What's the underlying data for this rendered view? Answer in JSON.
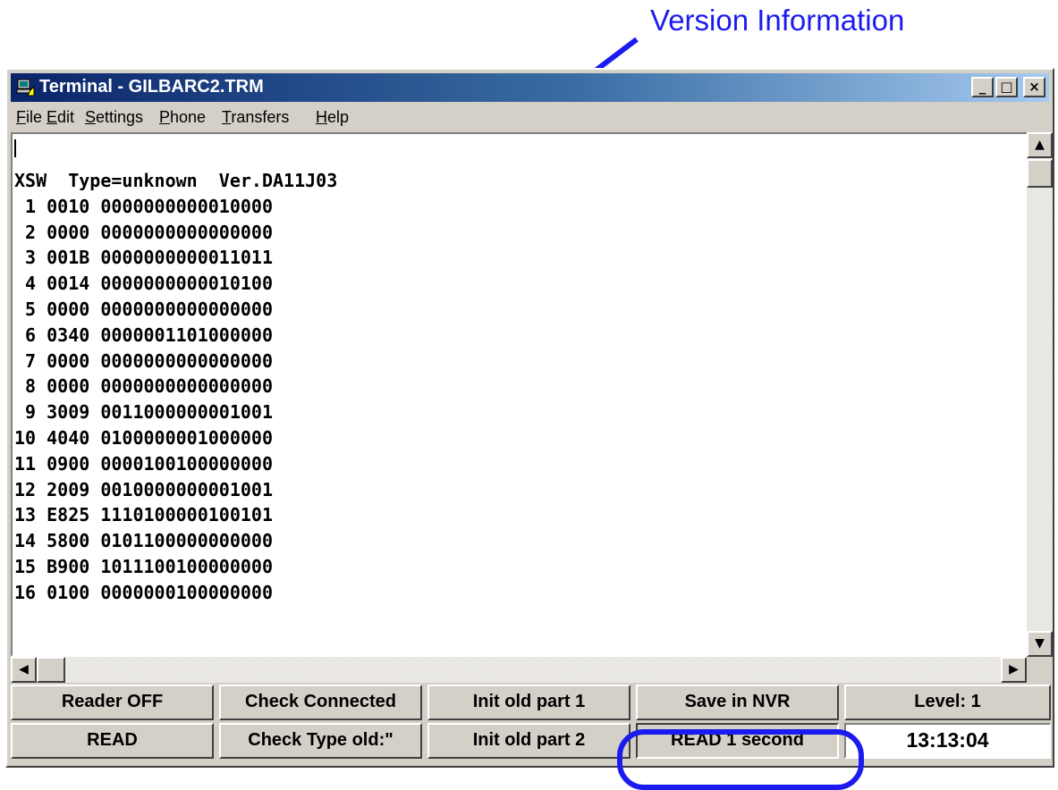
{
  "annotation": {
    "label": "Version Information",
    "color": "#1b1bf0"
  },
  "window": {
    "title": "Terminal - GILBARC2.TRM",
    "title_icon": "terminal-app-icon",
    "controls": {
      "minimize": "_",
      "maximize": "□",
      "close": "×"
    }
  },
  "menu": [
    {
      "mnemonic": "F",
      "rest": "ile"
    },
    {
      "mnemonic": "E",
      "rest": "dit"
    },
    {
      "mnemonic": "S",
      "rest": "ettings"
    },
    {
      "mnemonic": "P",
      "rest": "hone"
    },
    {
      "mnemonic": "T",
      "rest": "ransfers"
    },
    {
      "mnemonic": "H",
      "rest": "elp"
    }
  ],
  "terminal": {
    "lines": [
      "XSW  Type=unknown  Ver.DA11J03",
      " 1 0010 0000000000010000",
      " 2 0000 0000000000000000",
      " 3 001B 0000000000011011",
      " 4 0014 0000000000010100",
      " 5 0000 0000000000000000",
      " 6 0340 0000001101000000",
      " 7 0000 0000000000000000",
      " 8 0000 0000000000000000",
      " 9 3009 0011000000001001",
      "10 4040 0100000001000000",
      "11 0900 0000100100000000",
      "12 2009 0010000000001001",
      "13 E825 1110100000100101",
      "14 5800 0101100000000000",
      "15 B900 1011100100000000",
      "16 0100 0000000100000000"
    ]
  },
  "scrollbars": {
    "up_arrow": "▲",
    "down_arrow": "▼",
    "left_arrow": "◀",
    "right_arrow": "▶"
  },
  "buttons": {
    "row1": [
      "Reader OFF",
      "Check Connected",
      "Init old part 1",
      "Save in NVR",
      "Level: 1"
    ],
    "row2": [
      "READ",
      "Check Type old:\"",
      "Init old part 2",
      "READ 1 second",
      "13:13:04"
    ]
  }
}
